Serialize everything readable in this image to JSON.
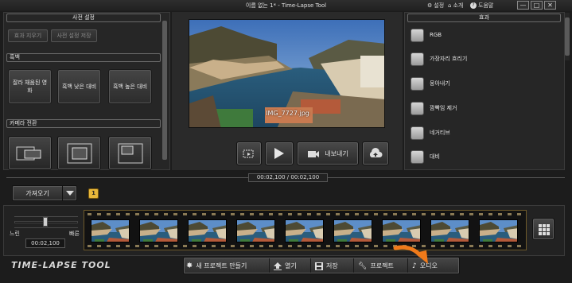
{
  "window": {
    "title": "이름 없는 1* - Time-Lapse Tool",
    "links": [
      {
        "icon": "gear-icon",
        "label": "설정"
      },
      {
        "icon": "home-icon",
        "label": "소개"
      },
      {
        "icon": "help-icon",
        "label": "도움말"
      }
    ]
  },
  "presets": {
    "title": "사전 설정",
    "remove_label": "효과 지우기",
    "save_label": "사전 설정 저장"
  },
  "bw": {
    "title": "흑백",
    "buttons": [
      "잘라 채움된 영화",
      "흑백 낮은 대비",
      "흑백 높은 대비"
    ]
  },
  "camera": {
    "title": "카메라 전환"
  },
  "preview": {
    "filename": "IMG_7727.jpg",
    "export_label": "내보내기"
  },
  "effects": {
    "title": "효과",
    "items": [
      "RGB",
      "가장자리 흐리기",
      "뭉아내기",
      "깜빡임 제거",
      "네거티브",
      "대비"
    ]
  },
  "timeline": {
    "time_readout": "00:02,100  /  00:02,100",
    "import_label": "가져오기",
    "badge": "1",
    "slow_label": "느린",
    "fast_label": "빠른",
    "duration": "00:02,100",
    "frame_count": 9
  },
  "footer": {
    "logo": "TIME-LAPSE TOOL",
    "new_project": "새 프로젝트 만들기",
    "open": "열기",
    "save": "저장",
    "project": "프로젝트",
    "audio": "오디오"
  }
}
